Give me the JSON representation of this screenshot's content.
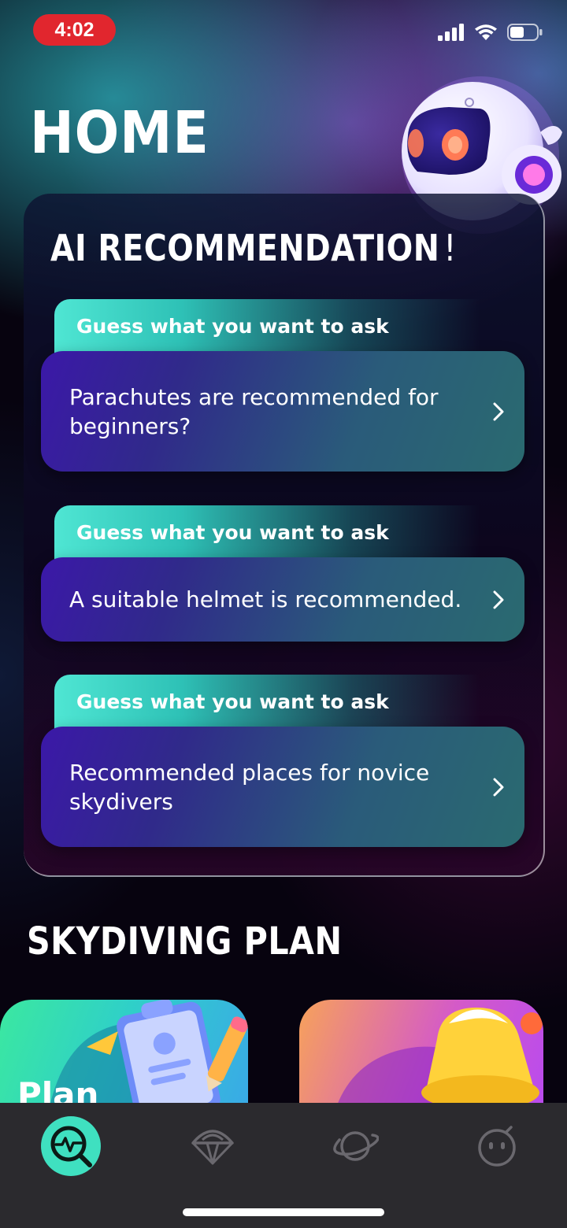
{
  "status_bar": {
    "time": "4:02"
  },
  "page_title": "HOME",
  "ai_section": {
    "heading": "AI RECOMMENDATION",
    "heading_suffix": "!",
    "items": [
      {
        "tag": "Guess what you want to ask",
        "question": "Parachutes are recommended for beginners?"
      },
      {
        "tag": "Guess what you want to ask",
        "question": "A suitable helmet is recommended."
      },
      {
        "tag": "Guess what you want to ask",
        "question": "Recommended places for novice skydivers"
      }
    ]
  },
  "plan_section": {
    "heading": "SKYDIVING PLAN",
    "cards": [
      {
        "label": "Plan",
        "icon": "clipboard-icon"
      },
      {
        "label": "",
        "icon": "bell-icon"
      }
    ]
  },
  "tab_bar": {
    "tabs": [
      {
        "icon": "search-pulse-icon",
        "active": true
      },
      {
        "icon": "parachute-icon",
        "active": false
      },
      {
        "icon": "planet-icon",
        "active": false
      },
      {
        "icon": "face-icon",
        "active": false
      }
    ]
  },
  "colors": {
    "accent": "#3fe0c0",
    "time_badge": "#e1262e",
    "tab_bar": "#2b2a2e"
  }
}
